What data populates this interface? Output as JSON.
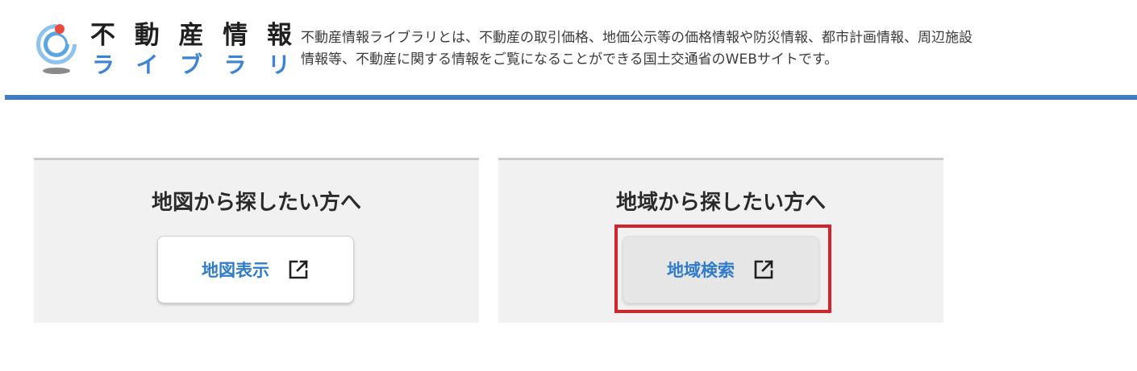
{
  "header": {
    "logo_chars_top": [
      "不",
      "動",
      "産",
      "情",
      "報"
    ],
    "logo_chars_bottom": [
      "ラ",
      "イ",
      "ブ",
      "ラ",
      "リ"
    ],
    "description_line1": "不動産情報ライブラリとは、不動産の取引価格、地価公示等の価格情報や防災情報、都市計画情報、周辺施設",
    "description_line2": "情報等、不動産に関する情報をご覧になることができる国土交通省のWEBサイトです。"
  },
  "panels": [
    {
      "title": "地図から探したい方へ",
      "button_label": "地図表示",
      "button_icon": "external-link-icon"
    },
    {
      "title": "地域から探したい方へ",
      "button_label": "地域検索",
      "button_icon": "external-link-icon"
    }
  ],
  "colors": {
    "brand_blue": "#3e7bc0",
    "link_blue": "#2f7ccc",
    "highlight_red": "#d6222a"
  }
}
